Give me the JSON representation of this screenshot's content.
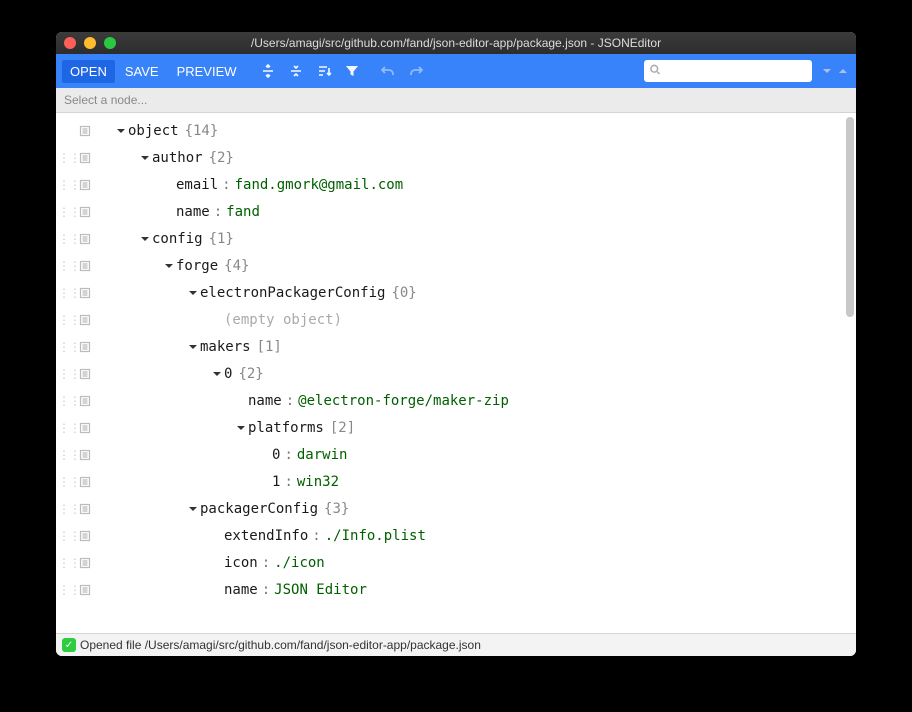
{
  "window": {
    "title": "/Users/amagi/src/github.com/fand/json-editor-app/package.json - JSONEditor"
  },
  "toolbar": {
    "open": "OPEN",
    "save": "SAVE",
    "preview": "PREVIEW"
  },
  "selectbar": {
    "placeholder": "Select a node..."
  },
  "status": {
    "text": "Opened file /Users/amagi/src/github.com/fand/json-editor-app/package.json"
  },
  "tree": {
    "rows": [
      {
        "indent": 0,
        "caret": "down",
        "key": "object",
        "count": "{14}",
        "noHandle": true
      },
      {
        "indent": 1,
        "caret": "down",
        "key": "author",
        "count": "{2}"
      },
      {
        "indent": 2,
        "caret": null,
        "key": "email",
        "sep": ":",
        "val": "fand.gmork@gmail.com"
      },
      {
        "indent": 2,
        "caret": null,
        "key": "name",
        "sep": ":",
        "val": "fand"
      },
      {
        "indent": 1,
        "caret": "down",
        "key": "config",
        "count": "{1}"
      },
      {
        "indent": 2,
        "caret": "down",
        "key": "forge",
        "count": "{4}"
      },
      {
        "indent": 3,
        "caret": "down",
        "key": "electronPackagerConfig",
        "count": "{0}"
      },
      {
        "indent": 4,
        "caret": null,
        "empty": "(empty object)"
      },
      {
        "indent": 3,
        "caret": "down",
        "key": "makers",
        "count": "[1]"
      },
      {
        "indent": 4,
        "caret": "down",
        "key": "0",
        "count": "{2}"
      },
      {
        "indent": 5,
        "caret": null,
        "key": "name",
        "sep": ":",
        "val": "@electron-forge/maker-zip"
      },
      {
        "indent": 5,
        "caret": "down",
        "key": "platforms",
        "count": "[2]"
      },
      {
        "indent": 6,
        "caret": null,
        "key": "0",
        "sep": ":",
        "val": "darwin"
      },
      {
        "indent": 6,
        "caret": null,
        "key": "1",
        "sep": ":",
        "val": "win32"
      },
      {
        "indent": 3,
        "caret": "down",
        "key": "packagerConfig",
        "count": "{3}"
      },
      {
        "indent": 4,
        "caret": null,
        "key": "extendInfo",
        "sep": ":",
        "val": "./Info.plist"
      },
      {
        "indent": 4,
        "caret": null,
        "key": "icon",
        "sep": ":",
        "val": "./icon"
      },
      {
        "indent": 4,
        "caret": null,
        "key": "name",
        "sep": ":",
        "val": "JSON Editor"
      }
    ]
  }
}
